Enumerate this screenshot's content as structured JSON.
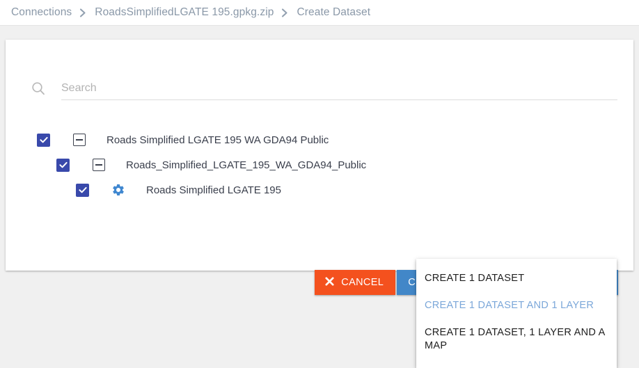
{
  "breadcrumb": {
    "items": [
      {
        "label": "Connections"
      },
      {
        "label": "RoadsSimplifiedLGATE 195.gpkg.zip"
      },
      {
        "label": "Create Dataset"
      }
    ],
    "separator": "❯"
  },
  "search": {
    "placeholder": "Search",
    "value": "",
    "icon": "search-icon"
  },
  "tree": {
    "rows": [
      {
        "label": "Roads Simplified LGATE 195 WA GDA94 Public",
        "checked": true,
        "level": 0,
        "icon": "collapse-toggle-icon"
      },
      {
        "label": "Roads_Simplified_LGATE_195_WA_GDA94_Public",
        "checked": true,
        "level": 1,
        "icon": "collapse-toggle-icon"
      },
      {
        "label": "Roads Simplified LGATE 195",
        "checked": true,
        "level": 2,
        "icon": "gear-icon"
      }
    ]
  },
  "actions": {
    "cancel_label": "CANCEL",
    "cancel_icon": "close-x-icon",
    "create_label": "CREATE 1 DATASET AND 1 LAYER",
    "create_divider": "|",
    "create_caret_icon": "chevron-down-icon"
  },
  "menu": {
    "items": [
      {
        "label": "CREATE 1 DATASET",
        "selected": false
      },
      {
        "label": "CREATE 1 DATASET AND 1 LAYER",
        "selected": true
      },
      {
        "label": "CREATE 1 DATASET, 1 LAYER AND A MAP",
        "selected": false
      }
    ]
  },
  "colors": {
    "page_background": "#f0f0f0",
    "card_background": "#ffffff",
    "checkbox_blue": "#3949ab",
    "accent_blue": "#4287c8",
    "cancel_orange": "#f4511e",
    "breadcrumb_gray": "#8a98a8",
    "menu_selected_blue": "#7ba7d9",
    "tree_text": "#3a3f4c"
  }
}
